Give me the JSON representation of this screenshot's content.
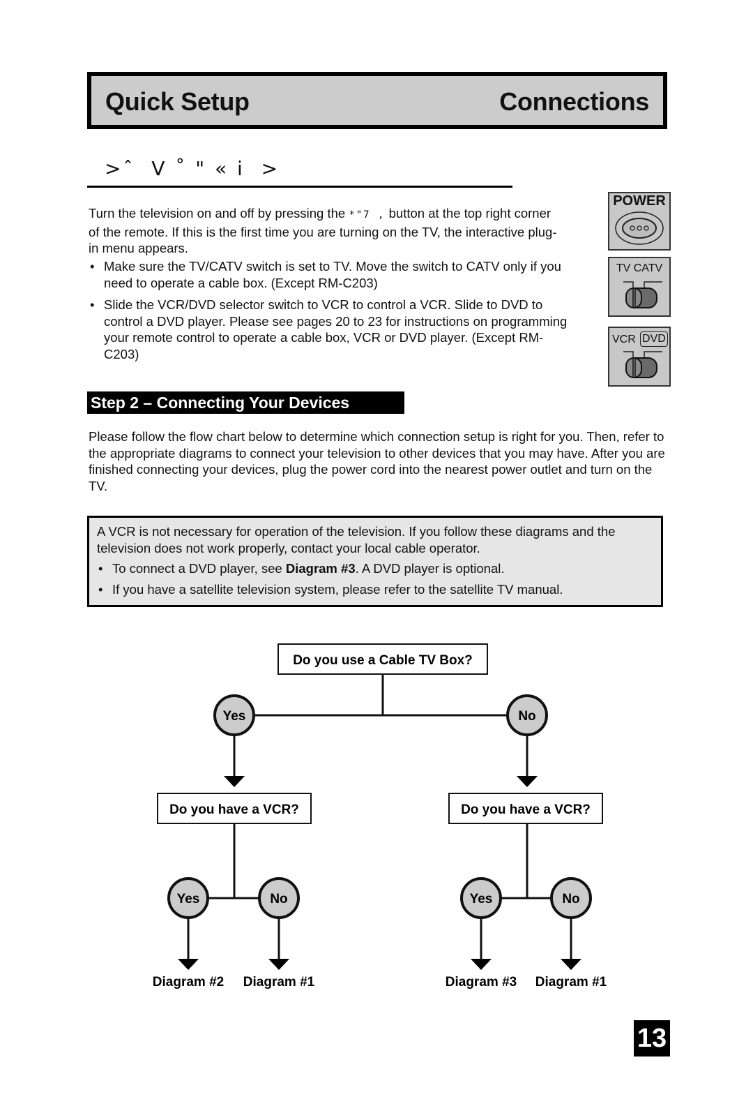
{
  "header": {
    "left_title": "Quick Setup",
    "right_title": "Connections"
  },
  "step1": {
    "heading_garbled": ">ˆ  V ˚ \" « i  >",
    "intro_before": "Turn the television on and off by pressing the ",
    "intro_garbled_button": "*\"7 ,",
    "intro_after": " button at the top right corner of the remote. If this is the first time you are turning on the TV, the interactive plug-in menu appears.",
    "bullets": [
      "Make sure the TV/CATV switch is set to TV. Move the switch to CATV only if you need to operate a cable box. (Except RM-C203)",
      "Slide the VCR/DVD selector switch to VCR to control a VCR. Slide to DVD to control a DVD player. Please see pages 20 to 23 for instructions on programming your remote control to operate a cable box, VCR or DVD player. (Except RM-C203)"
    ]
  },
  "remote_icons": {
    "power_label": "POWER",
    "tv_catv_label": "TV CATV",
    "vcr_label": "VCR",
    "dvd_label": "DVD",
    "tv_catv_position": "TV",
    "vcr_dvd_position": "VCR"
  },
  "step2": {
    "title": "Step 2 – Connecting Your Devices",
    "paragraph": "Please follow the flow chart below to determine which connection setup is right for you. Then, refer to the appropriate diagrams to connect your television to other devices that you may have. After you are finished connecting your devices, plug the power cord into the nearest power outlet and turn on the TV."
  },
  "note": {
    "text": "A VCR is not necessary for operation of the television. If you follow these diagrams and the television does not work properly, contact your local cable operator.",
    "bullet1_before": "To connect a DVD player, see ",
    "bullet1_bold": "Diagram #3",
    "bullet1_after": ". A DVD player is optional.",
    "bullet2": "If you have a satellite television system, please refer to the satellite TV manual."
  },
  "flowchart": {
    "root_question": "Do you use a Cable TV Box?",
    "root_yes": "Yes",
    "root_no": "No",
    "left_question": "Do you have a VCR?",
    "right_question": "Do you have a VCR?",
    "left_yes": "Yes",
    "left_no": "No",
    "right_yes": "Yes",
    "right_no": "No",
    "outcomes": [
      "Diagram #2",
      "Diagram #1",
      "Diagram #3",
      "Diagram #1"
    ],
    "node_fill": "#cccccc"
  },
  "page_number": "13"
}
